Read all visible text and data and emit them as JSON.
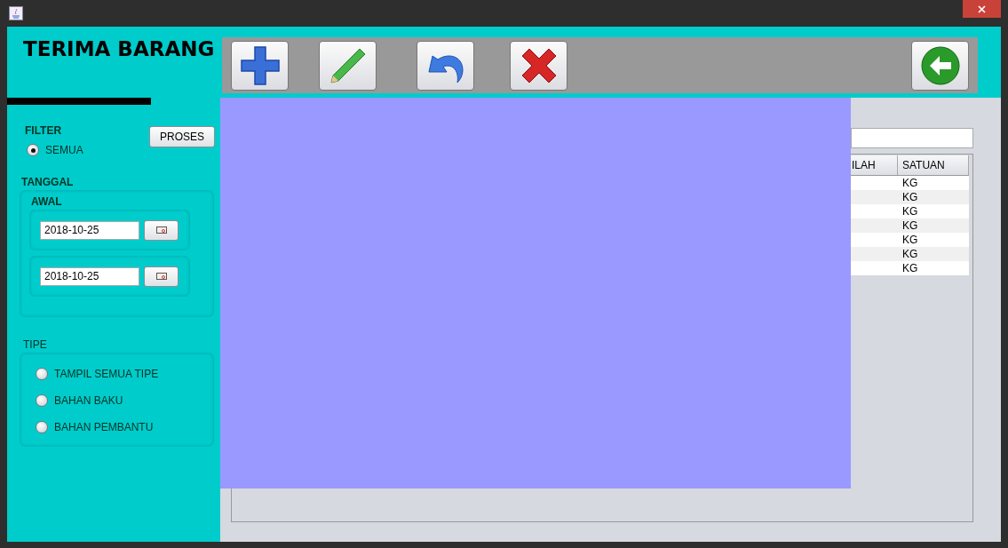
{
  "title": "TERIMA BARANG",
  "filter": {
    "label": "FILTER",
    "options": [
      {
        "label": "SEMUA",
        "selected": true
      }
    ],
    "button": "PROSES"
  },
  "tanggal": {
    "label": "TANGGAL",
    "sublabel": "AWAL",
    "dates": [
      "2018-10-25",
      "2018-10-25"
    ]
  },
  "tipe": {
    "label": "TIPE",
    "options": [
      {
        "label": "TAMPIL SEMUA TIPE",
        "selected": false
      },
      {
        "label": "BAHAN BAKU",
        "selected": false
      },
      {
        "label": "BAHAN PEMBANTU",
        "selected": false
      }
    ]
  },
  "toolbar": [
    {
      "kind": "add"
    },
    {
      "kind": "edit"
    },
    {
      "kind": "undo"
    },
    {
      "kind": "delete"
    },
    {
      "kind": "back"
    }
  ],
  "table": {
    "columns": [
      "ILAH",
      "SATUAN"
    ],
    "rows": [
      [
        "",
        "KG"
      ],
      [
        "",
        "KG"
      ],
      [
        "",
        "KG"
      ],
      [
        "",
        "KG"
      ],
      [
        "",
        "KG"
      ],
      [
        "",
        "KG"
      ],
      [
        "",
        "KG"
      ]
    ]
  }
}
